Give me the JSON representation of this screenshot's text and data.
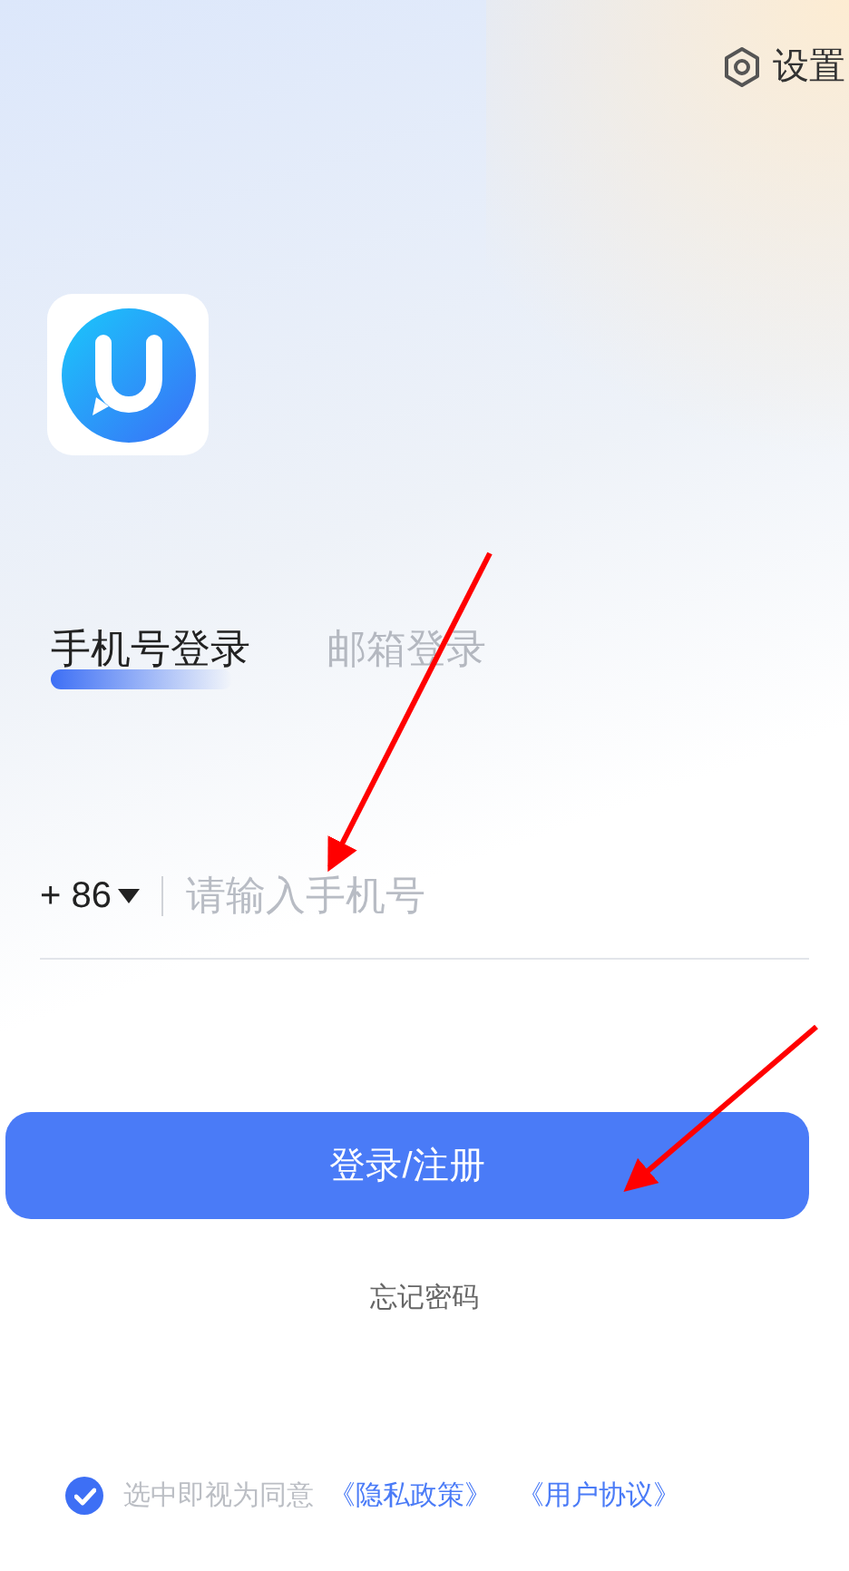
{
  "settings": {
    "label": "设置"
  },
  "tabs": [
    {
      "label": "手机号登录",
      "selected": true
    },
    {
      "label": "邮箱登录",
      "selected": false
    }
  ],
  "phone": {
    "country_code": "+ 86",
    "placeholder": "请输入手机号"
  },
  "login_button": {
    "label": "登录/注册"
  },
  "forgot_password": "忘记密码",
  "agreement": {
    "checked": true,
    "text": "选中即视为同意",
    "links": [
      "《隐私政策》",
      "《用户协议》"
    ]
  }
}
